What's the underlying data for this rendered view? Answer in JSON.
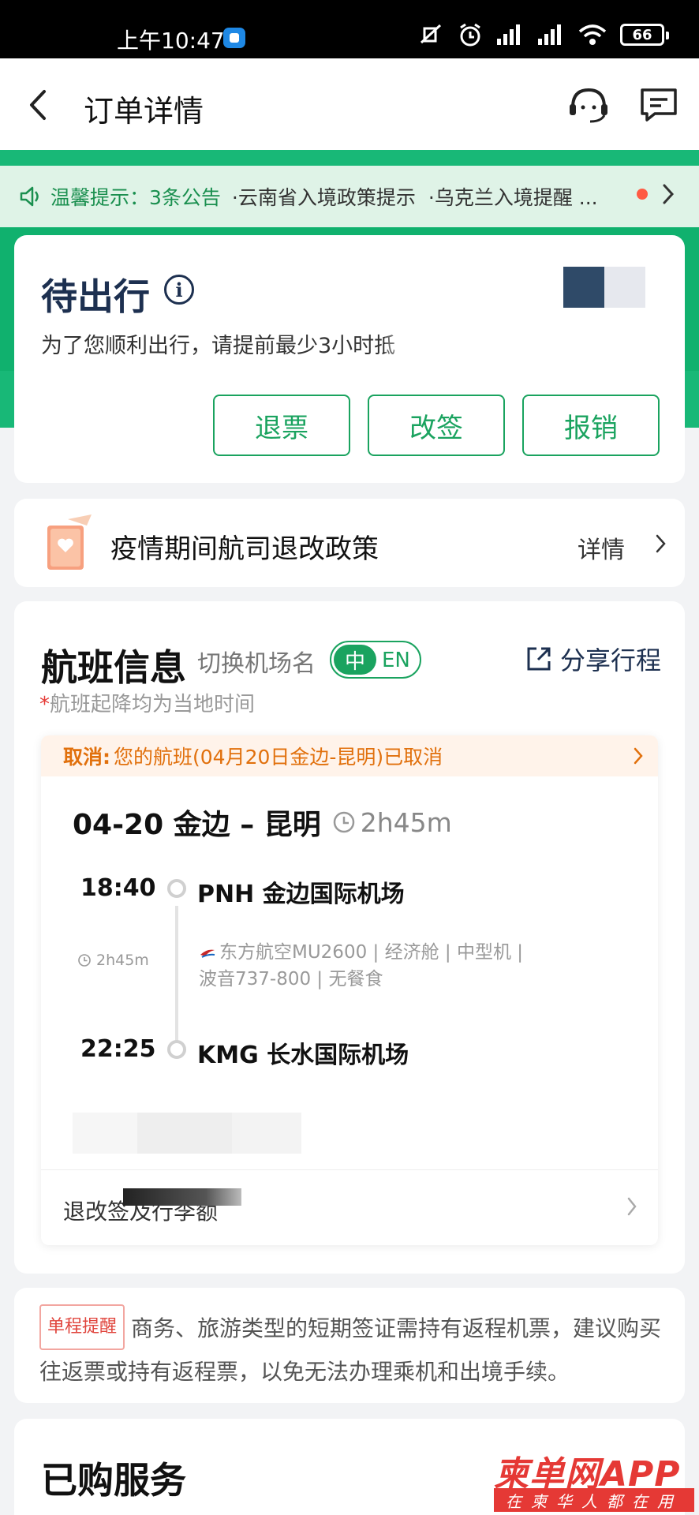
{
  "status_bar": {
    "time": "上午10:47",
    "battery": "66"
  },
  "nav": {
    "title": "订单详情"
  },
  "notice": {
    "label": "温馨提示：",
    "count": "3条公告",
    "items": [
      "·云南省入境政策提示",
      "·乌克兰入境提醒 ..."
    ]
  },
  "status": {
    "title": "待出行",
    "hint": "为了您顺利出行，请提前最少3小时抵",
    "actions": [
      "退票",
      "改签",
      "报销"
    ]
  },
  "policy": {
    "title": "疫情期间航司退改政策",
    "detail": "详情"
  },
  "flight": {
    "title": "航班信息",
    "switch_label": "切换机场名",
    "toggle_on": "中",
    "toggle_off": "EN",
    "share": "分享行程",
    "note_star": "*",
    "note": "航班起降均为当地时间",
    "cancel_label": "取消:",
    "cancel_text": "您的航班(04月20日金边-昆明)已取消",
    "route": "04-20 金边 – 昆明",
    "duration": "2h45m",
    "departure": {
      "time": "18:40",
      "airport": "PNH 金边国际机场"
    },
    "arrival": {
      "time": "22:25",
      "airport": "KMG 长水国际机场"
    },
    "mid_duration": "2h45m",
    "airline_line1": "东方航空MU2600 | 经济舱 | 中型机 |",
    "airline_line2": "波音737-800 | 无餐食",
    "refund_row": "退改签及行李额"
  },
  "visa": {
    "tag": "单程提醒",
    "text": "商务、旅游类型的短期签证需持有返程机票，建议购买往返票或持有返程票，以免无法办理乘机和出境手续。"
  },
  "services": {
    "title": "已购服务"
  },
  "watermark": {
    "logo": "柬单网APP",
    "sub": "在柬华人都在用"
  },
  "colors": {
    "brand_green": "#1aa35f",
    "header_green": "#18b877",
    "cancel_orange": "#e1700c",
    "status_navy": "#1d3050"
  }
}
